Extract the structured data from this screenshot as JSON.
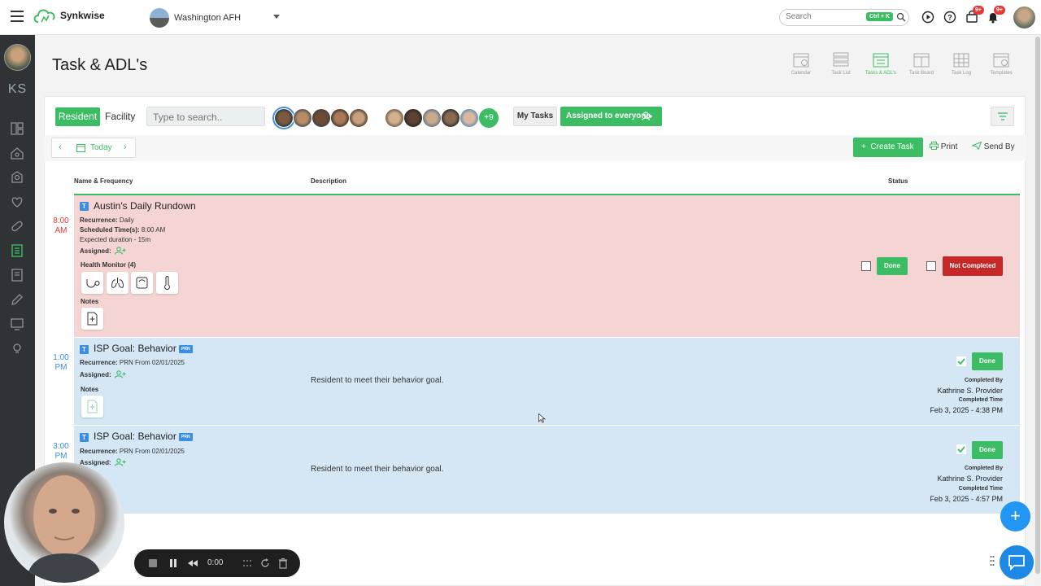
{
  "app": {
    "name": "Synkwise",
    "facility": "Washington AFH"
  },
  "topbar": {
    "search_placeholder": "Search",
    "search_shortcut": "Ctrl + K",
    "cart_badge": "9+",
    "notif_badge": "9+"
  },
  "sidebar": {
    "initials": "KS"
  },
  "page": {
    "title": "Task & ADL's"
  },
  "view_tabs": [
    {
      "label": "Calendar"
    },
    {
      "label": "Task List"
    },
    {
      "label": "Tasks & ADL's"
    },
    {
      "label": "Task Board"
    },
    {
      "label": "Task Log"
    },
    {
      "label": "Templates"
    }
  ],
  "filters": {
    "resident_label": "Resident",
    "facility_label": "Facility",
    "search_placeholder": "Type to search..",
    "more_residents": "+9",
    "my_tasks_label": "My Tasks",
    "assigned_label": "Assigned to everyone"
  },
  "toolbar": {
    "today_label": "Today",
    "create_label": "Create Task",
    "print_label": "Print",
    "send_label": "Send By"
  },
  "columns": {
    "name": "Name & Frequency",
    "description": "Description",
    "status": "Status"
  },
  "tasks": [
    {
      "time_line1": "8:00",
      "time_line2": "AM",
      "type": "T",
      "title": "Austin's Daily Rundown",
      "recurrence_label": "Recurrence:",
      "recurrence": "Daily",
      "scheduled_label": "Scheduled Time(s):",
      "scheduled": "8:00 AM",
      "duration": "Expected duration - 15m",
      "assigned_label": "Assigned:",
      "health_label": "Health Monitor (4)",
      "notes_label": "Notes",
      "done_label": "Done",
      "not_done_label": "Not Completed"
    },
    {
      "time_line1": "1:00",
      "time_line2": "PM",
      "type": "T",
      "title": "ISP Goal: Behavior",
      "prn": "PRN",
      "recurrence_label": "Recurrence:",
      "recurrence": "PRN From 02/01/2025",
      "assigned_label": "Assigned:",
      "notes_label": "Notes",
      "description": "Resident to meet their behavior goal.",
      "done_label": "Done",
      "completed_by_label": "Completed By",
      "completed_by": "Kathrine S. Provider",
      "completed_time_label": "Completed Time",
      "completed_time": "Feb 3, 2025 - 4:38 PM"
    },
    {
      "time_line1": "3:00",
      "time_line2": "PM",
      "type": "T",
      "title": "ISP Goal: Behavior",
      "prn": "PRN",
      "recurrence_label": "Recurrence:",
      "recurrence": "PRN From 02/01/2025",
      "assigned_label": "Assigned:",
      "description": "Resident to meet their behavior goal.",
      "done_label": "Done",
      "completed_by_label": "Completed By",
      "completed_by": "Kathrine S. Provider",
      "completed_time_label": "Completed Time",
      "completed_time": "Feb 3, 2025 - 4:57 PM"
    }
  ],
  "recorder": {
    "time": "0:00"
  },
  "colors": {
    "accent": "#3cbc63",
    "danger": "#c62828",
    "info": "#3a8ee6",
    "row_red": "#f5d5d4",
    "row_blue": "#d5e6f4"
  }
}
